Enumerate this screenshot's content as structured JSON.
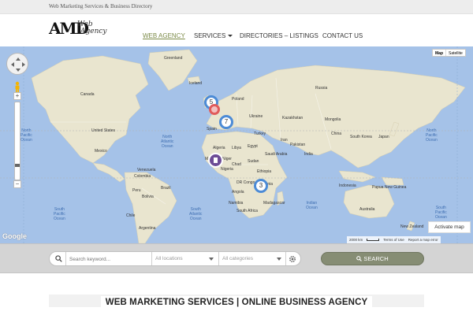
{
  "topbar": {
    "tagline": "Web Marketing Services & Business Directory"
  },
  "brand": {
    "mark": "AMD",
    "line1": "Web",
    "line2": "Agency"
  },
  "nav": [
    {
      "label": "WEB AGENCY",
      "active": true
    },
    {
      "label": "SERVICES",
      "has_dropdown": true
    },
    {
      "label": "DIRECTORIES – LISTINGS"
    },
    {
      "label": "CONTACT US"
    }
  ],
  "map": {
    "type_buttons": {
      "map": "Map",
      "satellite": "Satellite"
    },
    "labels": {
      "greenland": "Greenland",
      "iceland": "Iceland",
      "russia": "Russia",
      "canada": "Canada",
      "united_states": "United States",
      "mexico": "Mexico",
      "venezuela": "Venezuela",
      "colombia": "Colombia",
      "peru": "Peru",
      "brazil": "Brazil",
      "bolivia": "Bolivia",
      "argentina": "Argentina",
      "chile": "Chile",
      "spain": "Spain",
      "poland": "Poland",
      "ukraine": "Ukraine",
      "turkey": "Turkey",
      "algeria": "Algeria",
      "libya": "Libya",
      "egypt": "Egypt",
      "mali": "Mali",
      "niger": "Niger",
      "chad": "Chad",
      "sudan": "Sudan",
      "nigeria": "Nigeria",
      "ethiopia": "Ethiopia",
      "dr_congo": "DR Congo",
      "tanzania": "Tanzania",
      "angola": "Angola",
      "namibia": "Namibia",
      "south_africa": "South Africa",
      "madagascar": "Madagascar",
      "saudi_arabia": "Saudi Arabia",
      "iran": "Iran",
      "kazakhstan": "Kazakhstan",
      "mongolia": "Mongolia",
      "china": "China",
      "pakistan": "Pakistan",
      "india": "India",
      "japan": "Japan",
      "south_korea": "South Korea",
      "indonesia": "Indonesia",
      "papua_new_guinea": "Papua New Guinea",
      "australia": "Australia",
      "new_zealand": "New Zealand"
    },
    "oceans": {
      "north_pacific_w": "North\nPacific\nOcean",
      "north_pacific_e": "North\nPacific\nOcean",
      "north_atlantic": "North\nAtlantic\nOcean",
      "south_pacific_w": "South\nPacific\nOcean",
      "south_atlantic": "South\nAtlantic\nOcean",
      "indian": "Indian\nOcean",
      "south_pacific_e": "South\nPacific\nOcean"
    },
    "clusters": [
      {
        "count": "5",
        "color": "#4c8bd6"
      },
      {
        "count": "7",
        "color": "#4c8bd6"
      },
      {
        "count": "3",
        "color": "#4c8bd6"
      }
    ],
    "activate_label": "Activate map",
    "google_logo": "Google",
    "attribution": {
      "scale": "2000 km",
      "terms": "Terms of Use",
      "report": "Report a map error"
    }
  },
  "search": {
    "keyword_placeholder": "Search keyword...",
    "location_value": "All locations",
    "category_value": "All categories",
    "button_label": "Search"
  },
  "tagline": "WEB MARKETING SERVICES | ONLINE BUSINESS AGENCY"
}
